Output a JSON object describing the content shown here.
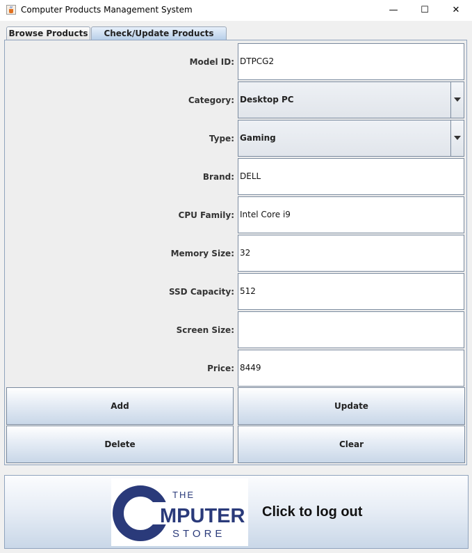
{
  "window": {
    "title": "Computer Products Management System",
    "minimize_symbol": "—",
    "maximize_symbol": "☐",
    "close_symbol": "✕"
  },
  "tabs": [
    {
      "label": "Browse Products"
    },
    {
      "label": "Check/Update Products Details"
    }
  ],
  "form": {
    "model_id": {
      "label": "Model ID:",
      "value": "DTPCG2"
    },
    "category": {
      "label": "Category:",
      "value": "Desktop PC"
    },
    "type": {
      "label": "Type:",
      "value": "Gaming"
    },
    "brand": {
      "label": "Brand:",
      "value": "DELL"
    },
    "cpu_family": {
      "label": "CPU Family:",
      "value": "Intel Core i9"
    },
    "memory_size": {
      "label": "Memory Size:",
      "value": "32"
    },
    "ssd_capacity": {
      "label": "SSD Capacity:",
      "value": "512"
    },
    "screen_size": {
      "label": "Screen Size:",
      "value": ""
    },
    "price": {
      "label": "Price:",
      "value": "8449"
    }
  },
  "buttons": {
    "add": "Add",
    "update": "Update",
    "delete": "Delete",
    "clear": "Clear"
  },
  "logout": {
    "label": "Click to log out",
    "logo": {
      "the": "THE",
      "computer": "MPUTER",
      "store": "STORE"
    }
  },
  "colors": {
    "logo_navy": "#2a3a7a",
    "tab_selected": "#b8cfe9"
  }
}
